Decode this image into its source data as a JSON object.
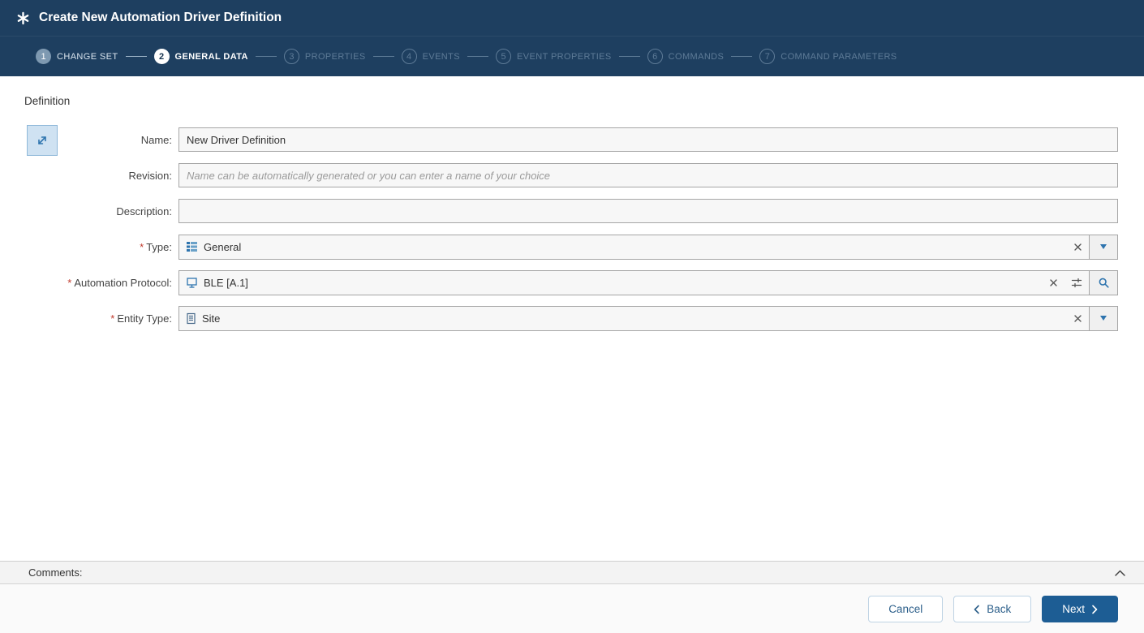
{
  "header": {
    "title": "Create New Automation Driver Definition"
  },
  "wizard": {
    "steps": [
      {
        "number": "1",
        "label": "CHANGE SET",
        "state": "completed"
      },
      {
        "number": "2",
        "label": "GENERAL DATA",
        "state": "active"
      },
      {
        "number": "3",
        "label": "PROPERTIES",
        "state": "upcoming"
      },
      {
        "number": "4",
        "label": "EVENTS",
        "state": "upcoming"
      },
      {
        "number": "5",
        "label": "EVENT PROPERTIES",
        "state": "upcoming"
      },
      {
        "number": "6",
        "label": "COMMANDS",
        "state": "upcoming"
      },
      {
        "number": "7",
        "label": "COMMAND PARAMETERS",
        "state": "upcoming"
      }
    ]
  },
  "form": {
    "section_title": "Definition",
    "required_marker": "*",
    "fields": {
      "name": {
        "label": "Name:",
        "value": "New Driver Definition"
      },
      "revision": {
        "label": "Revision:",
        "value": "",
        "placeholder": "Name can be automatically generated or you can enter a name of your choice"
      },
      "description": {
        "label": "Description:",
        "value": ""
      },
      "type": {
        "label": "Type:",
        "value": "General",
        "required": true
      },
      "automation_protocol": {
        "label": "Automation Protocol:",
        "value": "BLE [A.1]",
        "required": true
      },
      "entity_type": {
        "label": "Entity Type:",
        "value": "Site",
        "required": true
      }
    }
  },
  "comments": {
    "label": "Comments:"
  },
  "footer": {
    "cancel_label": "Cancel",
    "back_label": "Back",
    "next_label": "Next"
  },
  "icons": {
    "header": "asterisk-icon",
    "type_field": "list-table-icon",
    "automation_protocol_field": "monitor-icon",
    "entity_type_field": "document-icon",
    "clear": "clear-x-icon",
    "dropdown": "chevron-down-caret",
    "conditions": "filter-conditions-icon",
    "search": "magnifier-icon",
    "expand": "diagonal-arrow-icon",
    "collapse": "chevron-up-icon"
  },
  "colors": {
    "header_bg": "#1e3f60",
    "accent_blue": "#2e74ae",
    "primary_button": "#1d5d94",
    "required_red": "#c0392b"
  }
}
